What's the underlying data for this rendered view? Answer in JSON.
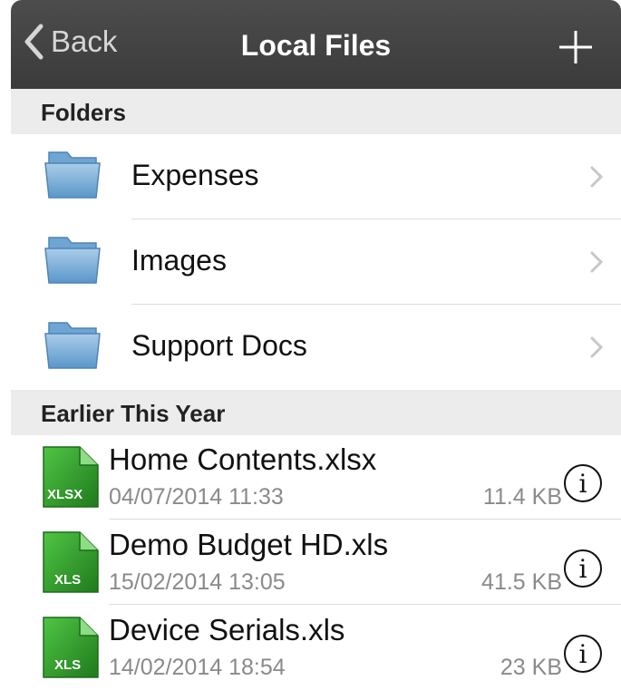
{
  "nav": {
    "back_label": "Back",
    "title": "Local Files",
    "add_icon": "plus-icon"
  },
  "sections": {
    "folders": "Folders",
    "recent": "Earlier This Year"
  },
  "folders": [
    {
      "name": "Expenses"
    },
    {
      "name": "Images"
    },
    {
      "name": "Support Docs"
    }
  ],
  "files": [
    {
      "name": "Home Contents.xlsx",
      "date": "04/07/2014 11:33",
      "size": "11.4 KB",
      "ext": "XLSX"
    },
    {
      "name": "Demo Budget HD.xls",
      "date": "15/02/2014 13:05",
      "size": "41.5 KB",
      "ext": "XLS"
    },
    {
      "name": "Device Serials.xls",
      "date": "14/02/2014 18:54",
      "size": "23 KB",
      "ext": "XLS"
    }
  ],
  "colors": {
    "navbar": "#434343",
    "section_bg": "#ececec",
    "xls_green": "#2f9a2a",
    "chevron": "#c7c7cc"
  }
}
